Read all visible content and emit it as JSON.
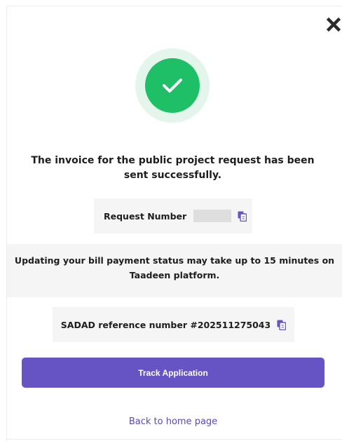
{
  "dialog": {
    "close_icon": "close-icon",
    "success_icon": "check-icon",
    "message": "The invoice for the public project request has been sent successfully.",
    "request": {
      "label": "Request Number",
      "copy_icon": "copy-icon"
    },
    "notice": "Updating your bill payment status may take up to 15 minutes on Taadeen platform.",
    "sadad": {
      "label": "SADAD reference number #202511275043",
      "copy_icon": "copy-icon"
    },
    "track_button_label": "Track Application",
    "home_link_label": "Back to home page"
  },
  "colors": {
    "accent": "#6754c4",
    "link": "#5b49b6",
    "success": "#1fbf68",
    "success_halo": "#e4f6ec",
    "panel": "#f5f5f5"
  }
}
